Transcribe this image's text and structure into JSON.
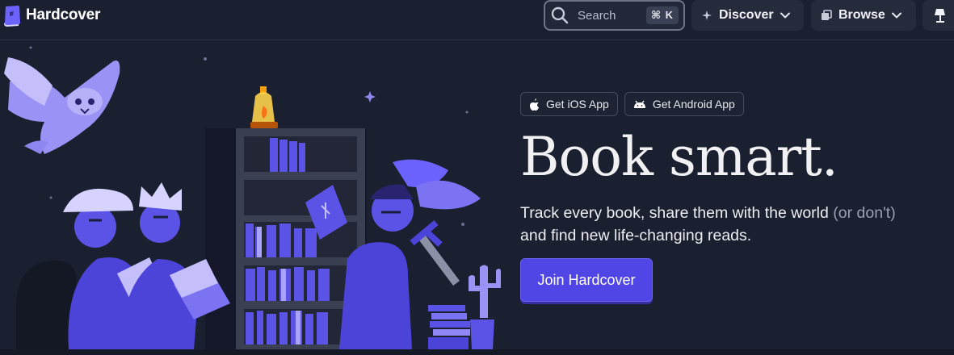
{
  "brand": {
    "name": "Hardcover"
  },
  "search": {
    "label": "Search",
    "shortcut": "⌘ K"
  },
  "nav": {
    "discover_label": "Discover",
    "browse_label": "Browse"
  },
  "hero": {
    "ios_app": "Get iOS App",
    "android_app": "Get Android App",
    "headline": "Book smart.",
    "tagline_main": "Track every book, share them with the world ",
    "tagline_muted": "(or don't)",
    "tagline_end": "and find new life-changing reads.",
    "cta": "Join Hardcover"
  },
  "colors": {
    "background": "#1b2030",
    "accent": "#4f46e5",
    "illustration_purple": "#5b52e6",
    "illustration_light": "#8f87f3"
  }
}
